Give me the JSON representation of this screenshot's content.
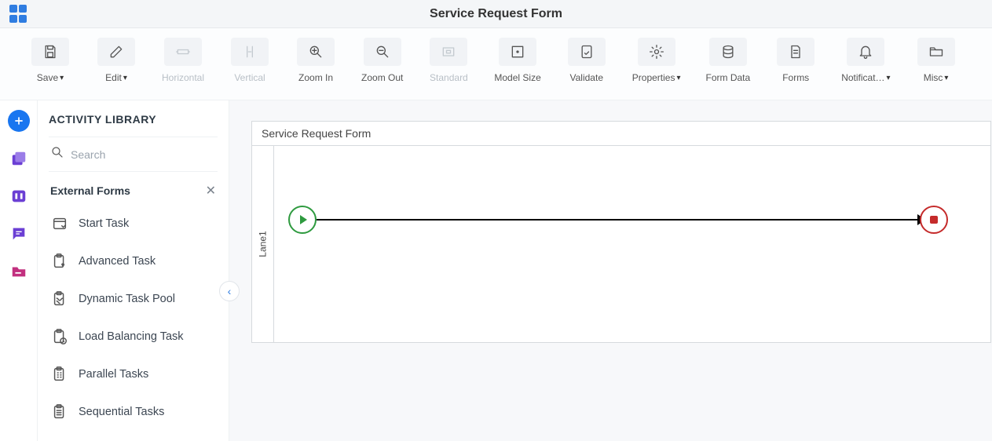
{
  "titlebar": {
    "title": "Service Request Form"
  },
  "toolbar": {
    "save": "Save",
    "edit": "Edit",
    "horizontal": "Horizontal",
    "vertical": "Vertical",
    "zoom_in": "Zoom In",
    "zoom_out": "Zoom Out",
    "standard": "Standard",
    "model_size": "Model Size",
    "validate": "Validate",
    "properties": "Properties",
    "form_data": "Form Data",
    "forms": "Forms",
    "notifications": "Notificat…",
    "misc": "Misc"
  },
  "sidebar": {
    "title": "ACTIVITY LIBRARY",
    "search_placeholder": "Search",
    "category": "External Forms",
    "items": [
      {
        "label": "Start Task",
        "icon": "start-task-icon"
      },
      {
        "label": "Advanced Task",
        "icon": "advanced-task-icon"
      },
      {
        "label": "Dynamic Task Pool",
        "icon": "dynamic-task-pool-icon"
      },
      {
        "label": "Load Balancing Task",
        "icon": "load-balancing-icon"
      },
      {
        "label": "Parallel Tasks",
        "icon": "parallel-tasks-icon"
      },
      {
        "label": "Sequential Tasks",
        "icon": "sequential-tasks-icon"
      }
    ]
  },
  "canvas": {
    "diagram_title": "Service Request Form",
    "lane_label": "Lane1"
  }
}
